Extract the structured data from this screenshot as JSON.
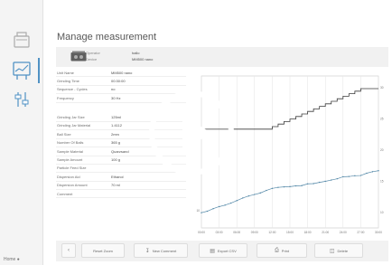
{
  "page": {
    "title": "Manage measurement"
  },
  "device": {
    "operator_label": "Operator",
    "operator_value": "hallo",
    "device_label": "Device",
    "device_value": "MM500 nano"
  },
  "properties": [
    {
      "key": "Unit Name",
      "value": "MM500 nano"
    },
    {
      "key": "Grinding Time",
      "value": "00:30:00"
    },
    {
      "key": "Sequence - Cycles",
      "value": "no"
    },
    {
      "key": "Frequency",
      "value": "30 Hz"
    },
    {
      "key": "Grinding Jar Size",
      "value": "125ml"
    },
    {
      "key": "Grinding Jar Material",
      "value": "1.4112"
    },
    {
      "key": "Ball Size",
      "value": "2mm"
    },
    {
      "key": "Number Of Balls",
      "value": "365 g"
    },
    {
      "key": "Sample Material",
      "value": "Quarzsand"
    },
    {
      "key": "Sample Amount",
      "value": "100 g"
    },
    {
      "key": "Particle Feed Size",
      "value": ""
    },
    {
      "key": "Dispersion Aid",
      "value": "Ethanol"
    },
    {
      "key": "Dispersion Amount",
      "value": "70 ml"
    },
    {
      "key": "Comment",
      "value": ""
    }
  ],
  "chart_data": {
    "type": "line",
    "x_ticks": [
      "00:00",
      "03:00",
      "06:00",
      "09:00",
      "12:00",
      "15:00",
      "18:00",
      "21:00",
      "24:00",
      "27:00",
      "30:00"
    ],
    "y_left_ticks": [
      "40",
      "30",
      "20",
      "10"
    ],
    "y_right_ticks": [
      "30",
      "25",
      "20",
      "15",
      "10"
    ],
    "series": [
      {
        "color": "#111111",
        "x_minutes": [
          0,
          11,
          12,
          13,
          14,
          15,
          16,
          17,
          18,
          19,
          20,
          21,
          22,
          23,
          24,
          25,
          26,
          27,
          28,
          30
        ],
        "values": [
          44,
          44,
          45,
          46,
          47,
          48,
          49,
          50,
          51,
          52,
          53,
          54,
          55,
          56,
          57,
          58,
          59,
          60,
          60,
          60
        ]
      },
      {
        "color": "#2f6f95",
        "x_minutes": [
          0,
          1,
          2,
          3,
          4,
          5,
          6,
          7,
          8,
          9,
          10,
          11,
          12,
          13,
          14,
          15,
          16,
          17,
          18,
          19,
          20,
          21,
          22,
          23,
          24,
          25,
          26,
          27,
          28,
          29,
          30
        ],
        "values": [
          11,
          11.6,
          12.6,
          13.4,
          14,
          14.8,
          15.8,
          16.8,
          17.6,
          18.2,
          18.8,
          19.8,
          20.6,
          21,
          21.2,
          21.3,
          21.6,
          21.7,
          22.4,
          22.5,
          23,
          23.4,
          23.9,
          24.4,
          25.2,
          25.3,
          25.6,
          25.7,
          26.6,
          27.2,
          27.6
        ]
      }
    ]
  },
  "toolbar": {
    "back_icon": "chevron-left",
    "reset_label": "Reset Zoom",
    "comment_label": "New Comment",
    "export_label": "Export CSV",
    "print_label": "Print",
    "delete_label": "Delete"
  },
  "rail": {
    "footer_label": "Home"
  }
}
